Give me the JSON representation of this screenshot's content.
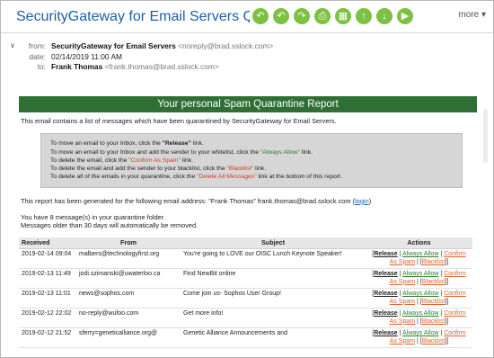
{
  "email": {
    "subject": "SecurityGateway for Email Servers Qua...",
    "more_label": "more",
    "from_label": "from:",
    "from_name": "SecurityGateway for Email Servers",
    "from_addr": "<noreply@brad.sslock.com>",
    "date_label": "date:",
    "date_value": "02/14/2019 11:00 AM",
    "to_label": "to:",
    "to_name": "Frank Thomas",
    "to_addr": "<frank.thomas@brad.sslock.com>"
  },
  "toolbar_icons": [
    "reply-icon",
    "reply-all-icon",
    "forward-icon",
    "print-icon",
    "delete-icon",
    "up-icon",
    "down-icon",
    "next-icon"
  ],
  "report": {
    "banner": "Your personal Spam Quarantine Report",
    "intro": "This email contains a list of messages which have been quarantined by SecurityGateway for Email Servers.",
    "instr1_pre": "To move an email to your Inbox, click the ",
    "instr1_link": "\"Release\"",
    "instr1_post": " link.",
    "instr2_pre": "To move an email to your Inbox and add the sender to your whitelist, click the ",
    "instr2_link": "\"Always Allow\"",
    "instr2_post": " link.",
    "instr3_pre": "To delete the email, click the ",
    "instr3_link": "\"Confirm As Spam\"",
    "instr3_post": " link.",
    "instr4_pre": "To delete the email and add the sender to your blacklist, click the ",
    "instr4_link": "\"Blacklist\"",
    "instr4_post": " link.",
    "instr5_pre": "To delete all of the emails in your quarantine, click the ",
    "instr5_link": "\"Delete All Messages\"",
    "instr5_post": " link at the bottom of this report.",
    "generated_pre": "This report has been generated for the following email address: \"Frank Thomas\" frank.thomas@brad.sslock.com (",
    "login_link": "login",
    "generated_post": ")",
    "count_line": "You have 8 message(s) in your quarantine folder.",
    "removal_line": "Messages older than 30 days will automatically be removed.",
    "columns": [
      "Received",
      "From",
      "Subject",
      "Actions"
    ],
    "action_labels": {
      "release": "Release",
      "always": "Always Allow",
      "confirm": "Confirm As Spam",
      "blacklist": "Blacklist"
    },
    "rows": [
      {
        "received": "2019-02-14 09:04",
        "from": "malbers@technologyfirst.org",
        "subject": "You're going to LOVE our OISC Lunch Keynote Speaker!"
      },
      {
        "received": "2019-02-13 11:49",
        "from": "jodi.szimanski@uwaterloo.ca",
        "subject": "Find NewBit online"
      },
      {
        "received": "2019-02-13 11:01",
        "from": "news@sophos.com",
        "subject": "Come join us- Sophos User Group!"
      },
      {
        "received": "2019-02-12 22:02",
        "from": "no-reply@wufoo.com",
        "subject": "Get more info!"
      },
      {
        "received": "2019-02-12 21:52",
        "from": "sferry=geneticalliance.org@",
        "subject": "Genetic Alliance Announcements and"
      }
    ]
  }
}
